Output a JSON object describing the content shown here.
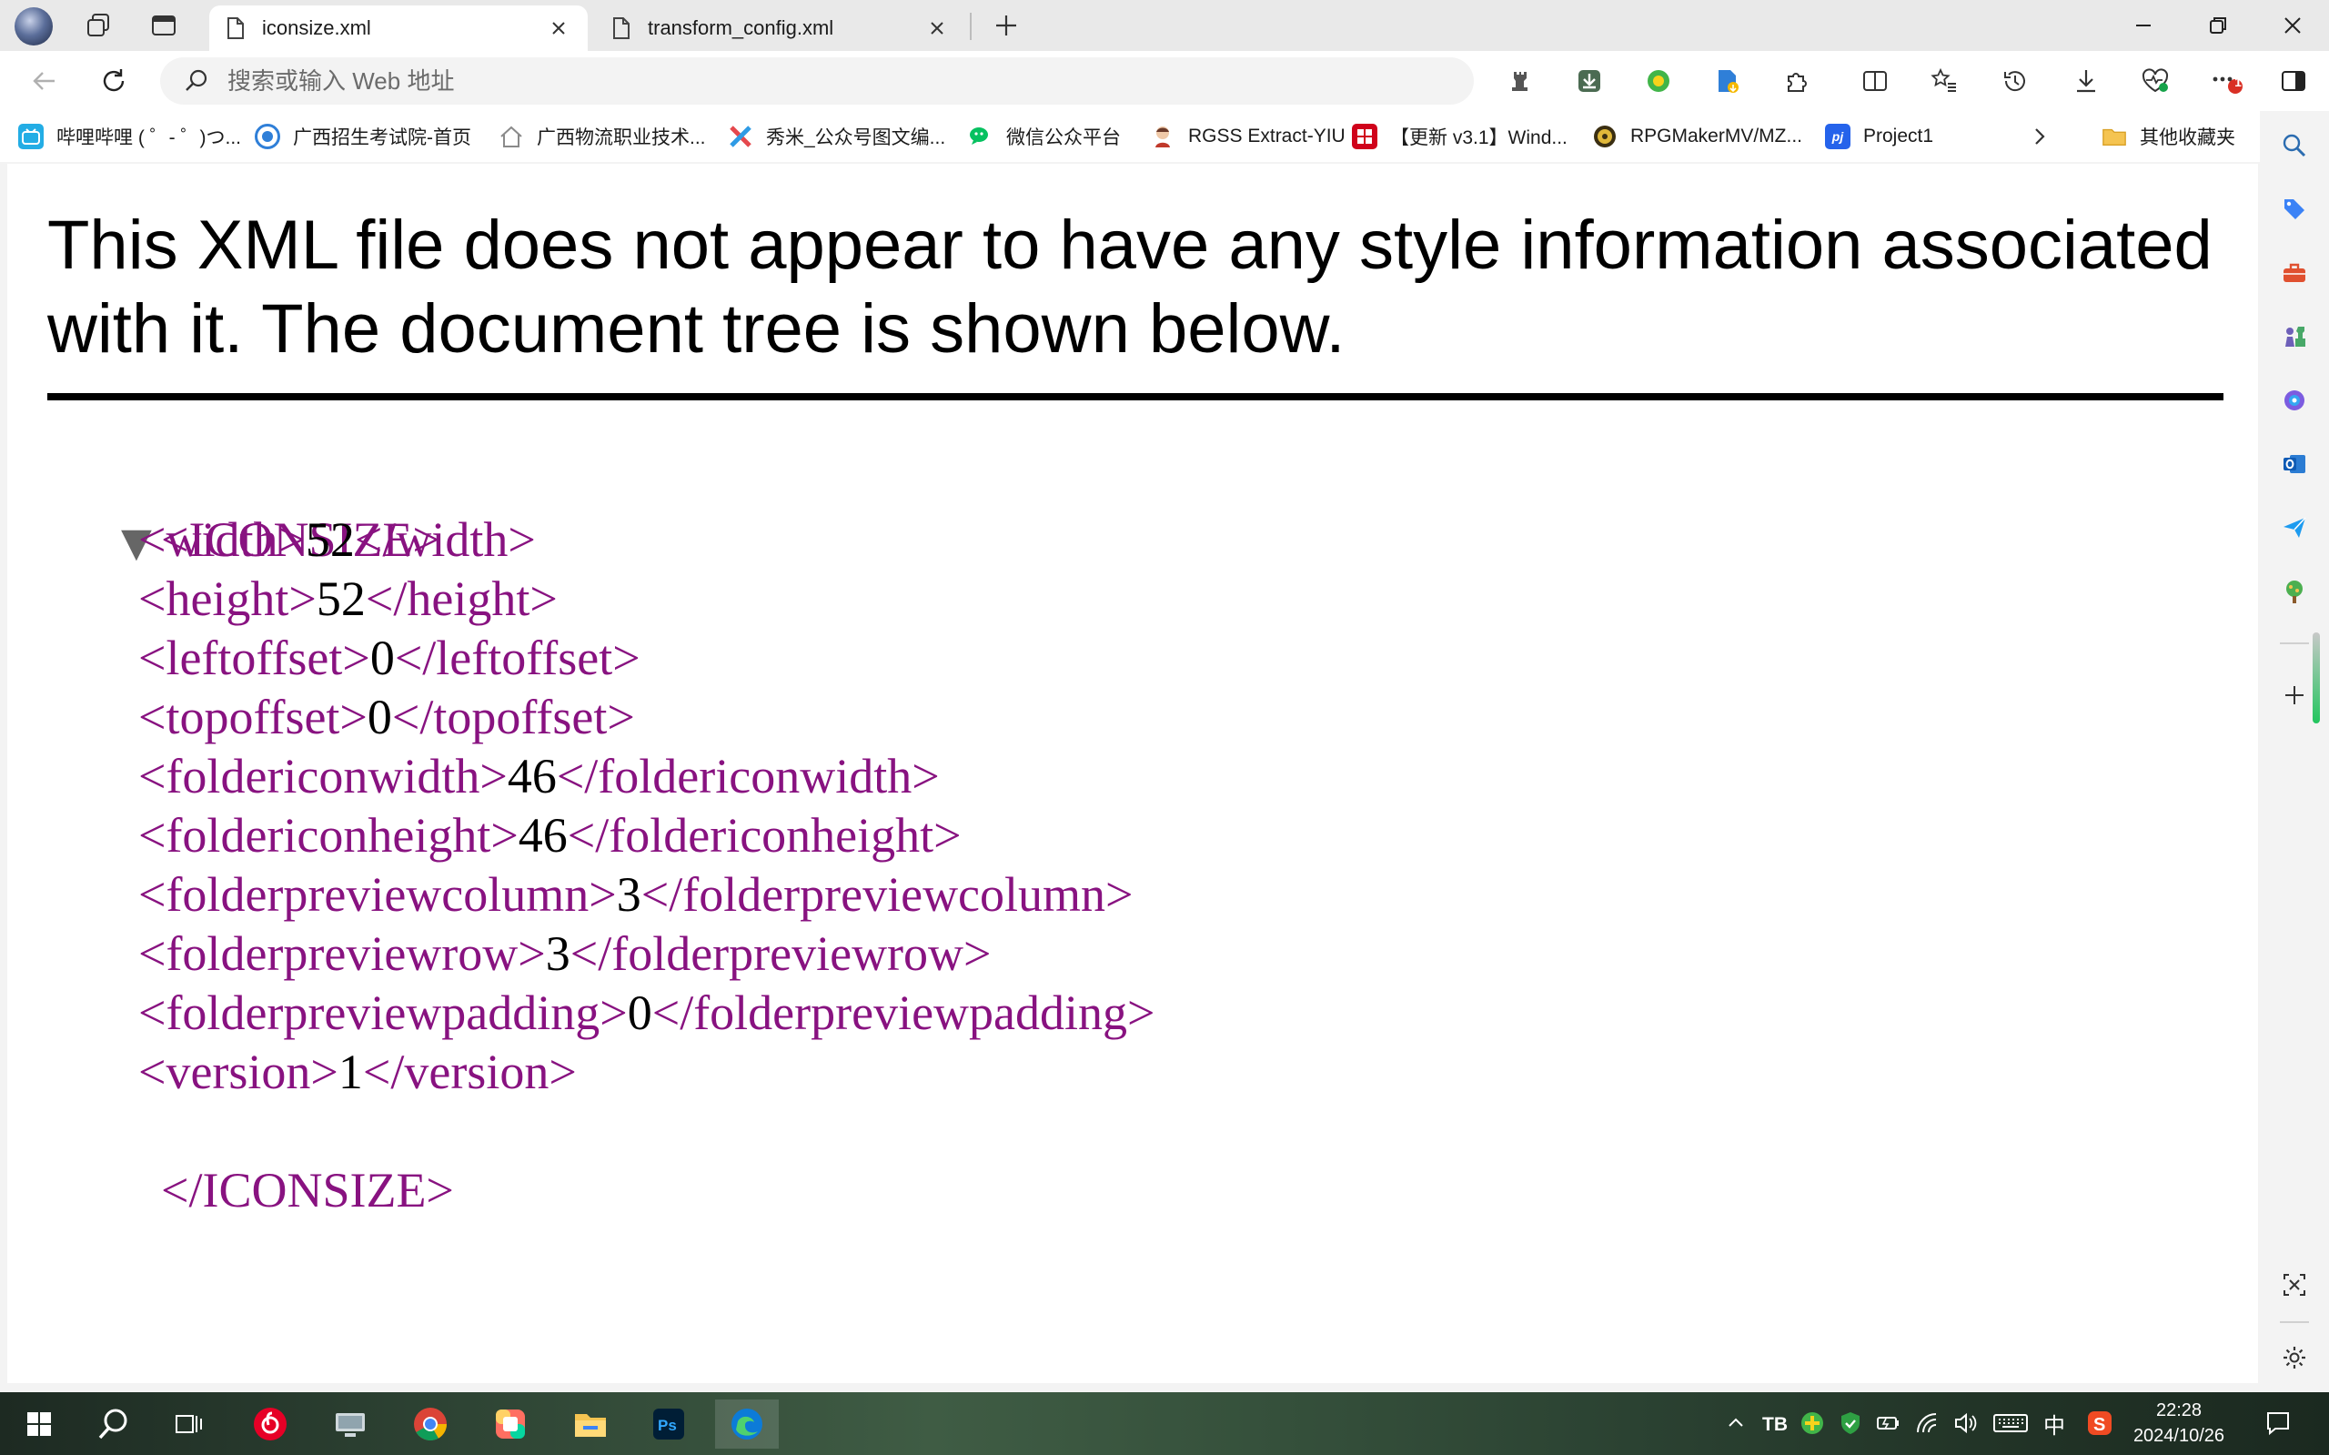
{
  "window": {
    "tabs": [
      {
        "title": "iconsize.xml",
        "active": true
      },
      {
        "title": "transform_config.xml",
        "active": false
      }
    ]
  },
  "toolbar": {
    "address_placeholder": "搜索或输入 Web 地址",
    "notification_badge": "1"
  },
  "favorites": [
    {
      "label": "哔哩哔哩 ( ゜- ゜)つ...",
      "icon": "bilibili-icon",
      "color": "#23ade5"
    },
    {
      "label": "广西招生考试院-首页",
      "icon": "globe-badge-icon",
      "color": "#2f7fd8"
    },
    {
      "label": "广西物流职业技术...",
      "icon": "house-icon",
      "color": "#8a8a8a"
    },
    {
      "label": "秀米_公众号图文编...",
      "icon": "xiumi-icon",
      "color": "#e5484d"
    },
    {
      "label": "微信公众平台",
      "icon": "wechat-icon",
      "color": "#07c160"
    },
    {
      "label": "RGSS Extract-YIU",
      "icon": "rgss-icon",
      "color": "#c0392b"
    },
    {
      "label": "【更新 v3.1】Wind...",
      "icon": "red-seal-icon",
      "color": "#d0021b"
    },
    {
      "label": "RPGMakerMV/MZ...",
      "icon": "rpgmaker-icon",
      "color": "#5b4a1a"
    },
    {
      "label": "Project1",
      "icon": "project-icon",
      "color": "#2563eb"
    }
  ],
  "favorites_more": "其他收藏夹",
  "page": {
    "notice": "This XML file does not appear to have any style information associated with it. The document tree is shown below.",
    "root_open": "<ICONSIZE>",
    "root_close": "</ICONSIZE>",
    "elements": [
      {
        "tag": "width",
        "value": "52"
      },
      {
        "tag": "height",
        "value": "52"
      },
      {
        "tag": "leftoffset",
        "value": "0"
      },
      {
        "tag": "topoffset",
        "value": "0"
      },
      {
        "tag": "foldericonwidth",
        "value": "46"
      },
      {
        "tag": "foldericonheight",
        "value": "46"
      },
      {
        "tag": "folderpreviewcolumn",
        "value": "3"
      },
      {
        "tag": "folderpreviewrow",
        "value": "3"
      },
      {
        "tag": "folderpreviewpadding",
        "value": "0"
      },
      {
        "tag": "version",
        "value": "1"
      }
    ]
  },
  "taskbar": {
    "ime_label": "中",
    "time": "22:28",
    "date": "2024/10/26"
  },
  "colors": {
    "xml_tag": "#881280",
    "taskbar_bg": "#2e4434"
  }
}
